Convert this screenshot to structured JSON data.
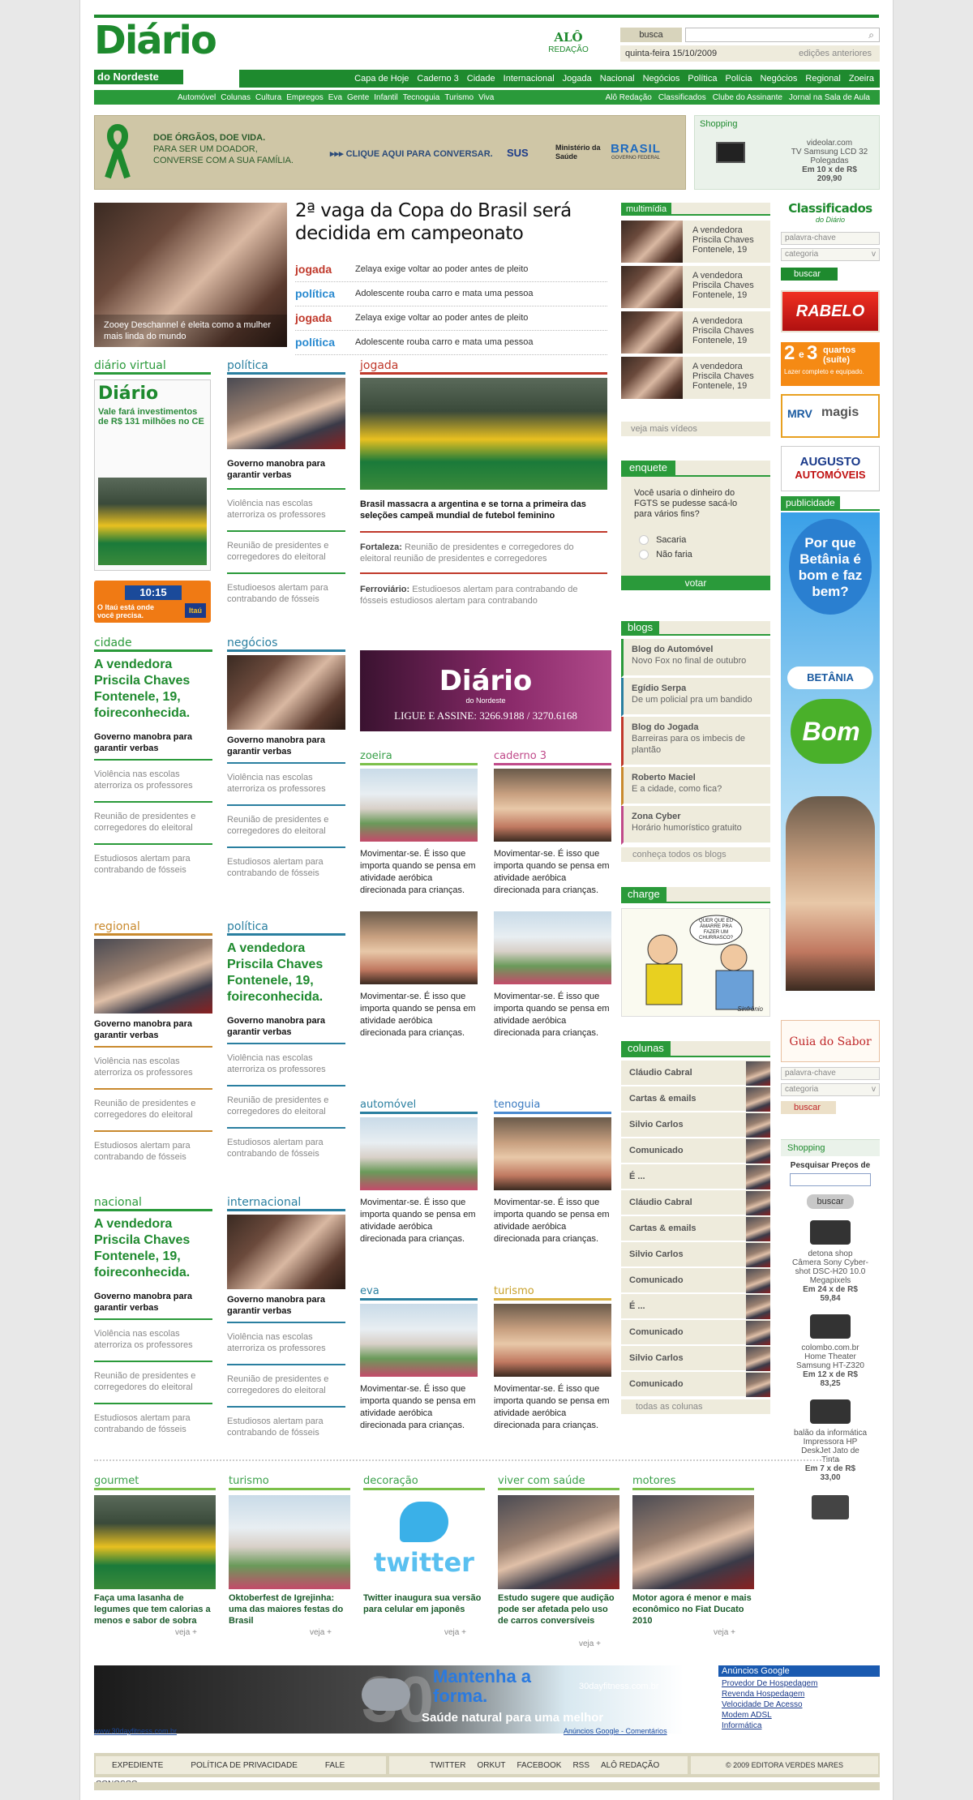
{
  "header": {
    "logo_main": "Diário",
    "logo_sub": "do Nordeste",
    "alo_label": "ALÔ",
    "alo_sub": "REDAÇÃO",
    "search_label": "busca",
    "date": "quinta-feira 15/10/2009",
    "editions": "edições anteriores"
  },
  "nav_main": [
    "Capa de Hoje",
    "Caderno 3",
    "Cidade",
    "Internacional",
    "Jogada",
    "Nacional",
    "Negócios",
    "Política",
    "Polícia",
    "Negócios",
    "Regional",
    "Zoeira"
  ],
  "nav_sub_left": [
    "Automóvel",
    "Colunas",
    "Cultura",
    "Empregos",
    "Eva",
    "Gente",
    "Infantil",
    "Tecnoguia",
    "Turismo",
    "Viva"
  ],
  "nav_sub_right": [
    "Alô Redação",
    "Classificados",
    "Clube do Assinante",
    "Jornal na Sala de Aula"
  ],
  "banner": {
    "line1": "DOE ÓRGÃOS, DOE VIDA.",
    "line2": "PARA SER UM DOADOR,",
    "line3": "CONVERSE COM A SUA FAMÍLIA.",
    "cta": "CLIQUE AQUI PARA CONVERSAR.",
    "sus": "SUS",
    "ministry": "Ministério da Saúde",
    "brasil": "BRASIL",
    "brasil_sub": "GOVERNO FEDERAL"
  },
  "shopping_top": {
    "title": "Shopping",
    "site": "videolar.com",
    "product": "TV Samsung LCD 32 Polegadas",
    "installments": "Em 10 x de R$",
    "price": "209,90"
  },
  "lead": {
    "caption": "Zooey Deschannel é eleita como a mulher mais linda do mundo",
    "headline": "2ª vaga da Copa do Brasil  será decidida em campeonato",
    "items": [
      {
        "tag": "jogada",
        "text": "Zelaya exige voltar ao poder antes de pleito"
      },
      {
        "tag": "política",
        "text": "Adolescente rouba carro e mata uma pessoa"
      },
      {
        "tag": "jogada",
        "text": "Zelaya exige voltar ao poder antes de pleito"
      },
      {
        "tag": "política",
        "text": "Adolescente rouba carro e mata uma pessoa"
      }
    ]
  },
  "diario_virtual": {
    "title": "diário virtual",
    "paper_logo": "Diário",
    "paper_head": "Vale fará investimentos de R$ 131 milhões no CE",
    "itau_time": "10:15",
    "itau_text": "O Itaú está onde você precisa.",
    "itau_logo": "Itaú"
  },
  "politica_col": {
    "title": "política",
    "head": "Governo manobra para garantir verbas",
    "s1": "Violência nas escolas aterroriza os professores",
    "s2": "Reunião de presidentes e corregedores do eleitoral",
    "s3": "Estudioesos alertam para contrabando de fósseis"
  },
  "jogada": {
    "title": "jogada",
    "head": "Brasil massacra a argentina e se torna a primeira das seleções campeã mundial de futebol feminino",
    "l1": "Fortaleza:",
    "t1": "Reunião de presidentes e corregedores do eleitoral reunião de presidentes e corregedores",
    "l2": "Ferroviário:",
    "t2": "Estudioesos alertam para contrabando de fósseis estudiosos alertam para contrabando"
  },
  "multimidia": {
    "title": "multimídia",
    "items": [
      "A vendedora Priscila Chaves Fontenele, 19",
      "A vendedora Priscila Chaves Fontenele, 19",
      "A vendedora Priscila Chaves Fontenele, 19",
      "A vendedora Priscila Chaves Fontenele, 19"
    ],
    "more": "veja mais vídeos"
  },
  "enquete": {
    "title": "enquete",
    "question": "Você usaria o dinheiro do FGTS se pudesse sacá-lo para vários fins?",
    "opt1": "Sacaria",
    "opt2": "Não faria",
    "vote": "votar"
  },
  "blogs": {
    "title": "blogs",
    "items": [
      {
        "name": "Blog do Automóvel",
        "desc": "Novo Fox no final de outubro"
      },
      {
        "name": "Egídio Serpa",
        "desc": "De um policial pra um bandido"
      },
      {
        "name": "Blog do Jogada",
        "desc": "Barreiras para os imbecis de plantão"
      },
      {
        "name": "Roberto Maciel",
        "desc": "E a cidade, como fica?"
      },
      {
        "name": "Zona Cyber",
        "desc": "Horário humorístico gratuito"
      }
    ],
    "more": "conheça todos os blogs"
  },
  "charge": {
    "title": "charge",
    "bubble": "QUER QUE EU AMARRE PRA FAZER UM CHURRASCO?",
    "sign": "Sinfrônio"
  },
  "colunas": {
    "title": "colunas",
    "items": [
      "Cláudio Cabral",
      "Cartas & emails",
      "Silvio Carlos",
      "Comunicado",
      "É ...",
      "Cláudio Cabral",
      "Cartas & emails",
      "Silvio Carlos",
      "Comunicado",
      "É ...",
      "Comunicado",
      "Silvio Carlos",
      "Comunicado"
    ],
    "more": "todas as colunas"
  },
  "classificados": {
    "title": "Classificados",
    "sub": "do Diário",
    "kw": "palavra-chave",
    "cat": "categoria",
    "btn": "buscar"
  },
  "ads_right": {
    "rabelo": "RABELO",
    "quartos_a": "2",
    "quartos_b": "3",
    "quartos_c": "quartos (suíte)",
    "quartos_d": "Lazer completo e equipado.",
    "mrv": "MRV",
    "magis": "magis",
    "augusto": "AUGUSTO",
    "auto": "AUTOMÓVEIS",
    "publicidade": "publicidade",
    "betania1": "Por que Betânia é bom e faz bem?",
    "betania2": "BETÂNIA",
    "bom": "Bom"
  },
  "guia": {
    "title": "Guia do Sabor",
    "kw": "palavra-chave",
    "cat": "categoria",
    "btn": "buscar"
  },
  "shopping_right": {
    "title": "Shopping",
    "label": "Pesquisar Preços de",
    "btn": "buscar",
    "items": [
      {
        "store": "detona shop",
        "name": "Câmera Sony Cyber-shot DSC-H20 10.0 Megapixels",
        "inst": "Em 24 x de R$",
        "price": "59,84"
      },
      {
        "store": "colombo.com.br",
        "name": "Home Theater Samsung HT-Z320",
        "inst": "Em 12 x de R$",
        "price": "83,25"
      },
      {
        "store": "balão da informática",
        "name": "Impressora HP DeskJet Jato de Tinta",
        "inst": "Em 7 x de R$",
        "price": "33,00"
      }
    ]
  },
  "blocks": [
    {
      "title": "cidade",
      "lead": "A vendedora Priscila Chaves Fontenele, 19, foireconhecida.",
      "head": "Governo manobra para garantir verbas",
      "s1": "Violência nas escolas aterroriza os professores",
      "s2": "Reunião de presidentes e corregedores do eleitoral",
      "s3": "Estudiosos alertam para contrabando de fósseis"
    },
    {
      "title": "negócios",
      "head": "Governo manobra para garantir verbas",
      "s1": "Violência nas escolas aterroriza os professores",
      "s2": "Reunião de presidentes e corregedores do eleitoral",
      "s3": "Estudiosos alertam para contrabando de fósseis"
    },
    {
      "title": "regional",
      "head": "Governo manobra para garantir verbas",
      "s1": "Violência nas escolas aterroriza os professores",
      "s2": "Reunião de presidentes e corregedores do eleitoral",
      "s3": "Estudiosos alertam para contrabando de fósseis"
    },
    {
      "title": "política",
      "lead": "A vendedora Priscila Chaves Fontenele, 19, foireconhecida.",
      "head": "Governo manobra para garantir verbas",
      "s1": "Violência nas escolas aterroriza os professores",
      "s2": "Reunião de presidentes e corregedores do eleitoral",
      "s3": "Estudiosos alertam para contrabando de fósseis"
    },
    {
      "title": "nacional",
      "lead": "A vendedora Priscila Chaves Fontenele, 19, foireconhecida.",
      "head": "Governo manobra para garantir verbas",
      "s1": "Violência nas escolas aterroriza os professores",
      "s2": "Reunião de presidentes e corregedores do eleitoral",
      "s3": "Estudiosos alertam para contrabando de fósseis"
    },
    {
      "title": "internacional",
      "head": "Governo manobra para garantir verbas",
      "s1": "Violência nas escolas aterroriza os professores",
      "s2": "Reunião de presidentes e corregedores do eleitoral",
      "s3": "Estudiosos alertam para contrabando de fósseis"
    }
  ],
  "diario_ad": {
    "logo": "Diário",
    "sub": "do Nordeste",
    "phone": "LIGUE E ASSINE: 3266.9188 / 3270.6168"
  },
  "small": [
    {
      "title": "zoeira"
    },
    {
      "title": "caderno 3"
    },
    {
      "title": ""
    },
    {
      "title": ""
    },
    {
      "title": "automóvel"
    },
    {
      "title": "tenoguia"
    },
    {
      "title": "eva"
    },
    {
      "title": "turismo"
    }
  ],
  "small_text": "Movimentar-se. É isso que importa quando se pensa em atividade aeróbica direcionada para crianças.",
  "bottom": [
    {
      "title": "gourmet",
      "text": "Faça uma lasanha de legumes que tem calorias a menos e sabor de sobra"
    },
    {
      "title": "turismo",
      "text": "Oktoberfest de Igrejinha: uma das maiores festas do Brasil"
    },
    {
      "title": "decoração",
      "text": "Twitter inaugura sua versão para celular em japonês"
    },
    {
      "title": "viver com saúde",
      "text": "Estudo sugere que audição pode ser afetada pelo uso de carros conversíveis"
    },
    {
      "title": "motores",
      "text": "Motor agora é menor e mais econômico no Fiat Ducato 2010"
    }
  ],
  "veja": "veja +",
  "twitter_word": "twitter",
  "fitness": {
    "title": "Mantenha a forma.",
    "sub": "Saúde natural para uma melhor",
    "site": "30dayfitness.com.br",
    "url": "www.30dayfitness.com.br",
    "google": "Anúncios Google - Comentários",
    "big": "30"
  },
  "google_ads": {
    "title": "Anúncios Google",
    "items": [
      "Provedor De Hospedagem",
      "Revenda Hospedagem",
      "Velocidade De Acesso",
      "Modem ADSL",
      "Informática"
    ]
  },
  "footer": {
    "left": [
      "EXPEDIENTE",
      "POLÍTICA DE PRIVACIDADE",
      "FALE CONOSCO"
    ],
    "mid": [
      "TWITTER",
      "ORKUT",
      "FACEBOOK",
      "RSS",
      "ALÔ REDAÇÃO"
    ],
    "copy": "© 2009 EDITORA VERDES MARES"
  }
}
